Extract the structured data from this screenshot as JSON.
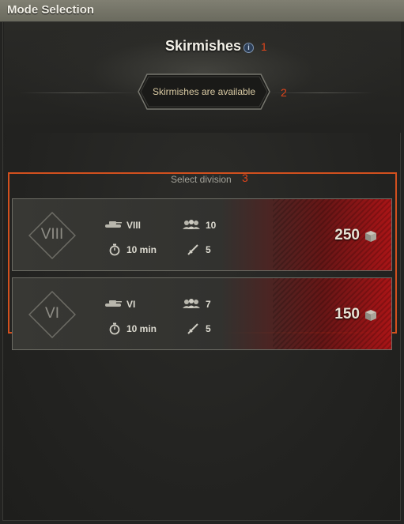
{
  "window": {
    "title": "Mode Selection"
  },
  "mode": {
    "title": "Skirmishes",
    "info_icon": "info-icon",
    "status": "Skirmishes are available"
  },
  "markers": {
    "m1": "1",
    "m2": "2",
    "m3": "3"
  },
  "select_label": "Select division",
  "divisions": [
    {
      "tier": "VIII",
      "tank_tier": "VIII",
      "players": "10",
      "duration": "10 min",
      "battles": "5",
      "reward": "250"
    },
    {
      "tier": "VI",
      "tank_tier": "VI",
      "players": "7",
      "duration": "10 min",
      "battles": "5",
      "reward": "150"
    }
  ],
  "colors": {
    "accent_orange": "#d2501e",
    "marker_red": "#e0451b",
    "reward_red": "#aa1416"
  },
  "icons": {
    "tank": "tank-icon",
    "players": "players-icon",
    "timer": "stopwatch-icon",
    "battles": "rifle-icon",
    "reward": "crate-icon"
  }
}
